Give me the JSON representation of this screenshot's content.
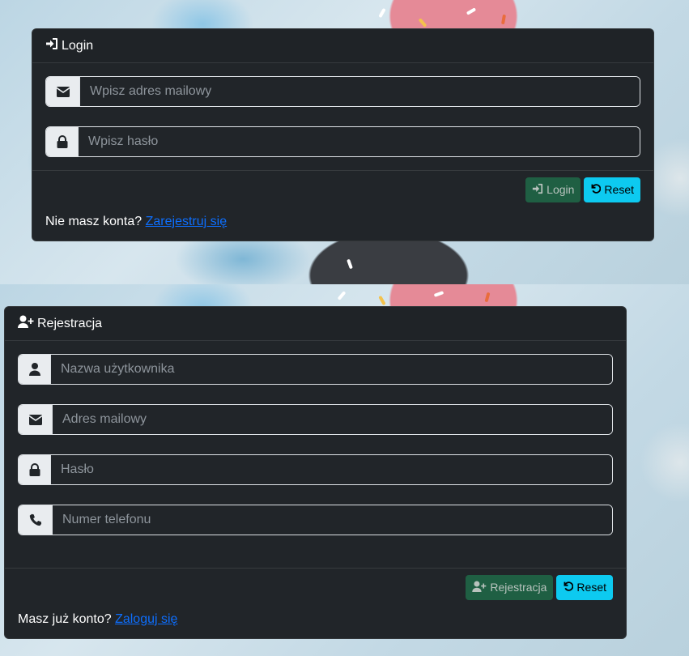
{
  "login": {
    "title": "Login",
    "email_placeholder": "Wpisz adres mailowy",
    "password_placeholder": "Wpisz hasło",
    "login_button": "Login",
    "reset_button": "Reset",
    "no_account_text": "Nie masz konta?",
    "register_link": "Zarejestruj się",
    "icons": {
      "header": "sign-in-icon",
      "email": "envelope-icon",
      "password": "lock-icon"
    }
  },
  "register": {
    "title": "Rejestracja",
    "username_placeholder": "Nazwa użytkownika",
    "email_placeholder": "Adres mailowy",
    "password_placeholder": "Hasło",
    "phone_placeholder": "Numer telefonu",
    "register_button": "Rejestracja",
    "reset_button": "Reset",
    "have_account_text": "Masz już konto?",
    "login_link": "Zaloguj się",
    "icons": {
      "header": "user-plus-icon",
      "username": "user-icon",
      "email": "envelope-icon",
      "password": "lock-icon",
      "phone": "phone-icon"
    }
  },
  "colors": {
    "card_bg": "#212529",
    "success": "#1f5f43",
    "info": "#0dcaf0",
    "link": "#0d6efd"
  }
}
